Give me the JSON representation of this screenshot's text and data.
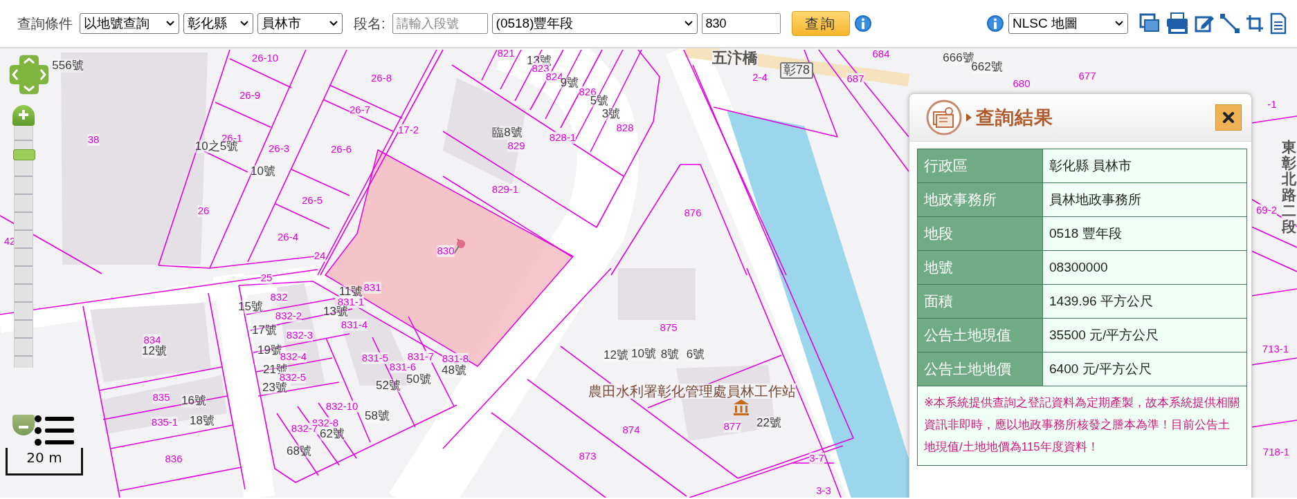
{
  "toolbar": {
    "query_label": "查詢條件",
    "query_mode": "以地號查詢",
    "county": "彰化縣",
    "town": "員林市",
    "section_label": "段名:",
    "section_input": {
      "placeholder": "請輸入段號"
    },
    "section": "(0518)豐年段",
    "parcel_input": {
      "value": "830"
    },
    "query_button": "查詢",
    "basemap": "NLSC 地圖"
  },
  "map": {
    "zoom_slider": {
      "level": 0.9
    },
    "scale_label": "20 m",
    "labels": [
      {
        "text": "556號",
        "kind": "address"
      },
      {
        "text": "26-10",
        "kind": "parcel"
      },
      {
        "text": "26-8",
        "kind": "parcel"
      },
      {
        "text": "26-9",
        "kind": "parcel"
      },
      {
        "text": "38",
        "kind": "parcel"
      },
      {
        "text": "26-1",
        "kind": "parcel"
      },
      {
        "text": "10之5號",
        "kind": "address"
      },
      {
        "text": "26-3",
        "kind": "parcel"
      },
      {
        "text": "26-6",
        "kind": "parcel"
      },
      {
        "text": "17-2",
        "kind": "parcel"
      },
      {
        "text": "26-7",
        "kind": "parcel"
      },
      {
        "text": "10號",
        "kind": "address"
      },
      {
        "text": "26-5",
        "kind": "parcel"
      },
      {
        "text": "26",
        "kind": "parcel"
      },
      {
        "text": "26-4",
        "kind": "parcel"
      },
      {
        "text": "24",
        "kind": "parcel"
      },
      {
        "text": "42",
        "kind": "parcel"
      },
      {
        "text": "830",
        "kind": "parcel"
      },
      {
        "text": "25",
        "kind": "parcel"
      },
      {
        "text": "832",
        "kind": "parcel"
      },
      {
        "text": "11號",
        "kind": "address"
      },
      {
        "text": "831",
        "kind": "parcel"
      },
      {
        "text": "15號",
        "kind": "address"
      },
      {
        "text": "831-1",
        "kind": "parcel"
      },
      {
        "text": "832-2",
        "kind": "parcel"
      },
      {
        "text": "13號",
        "kind": "address"
      },
      {
        "text": "831-4",
        "kind": "parcel"
      },
      {
        "text": "17號",
        "kind": "address"
      },
      {
        "text": "832-3",
        "kind": "parcel"
      },
      {
        "text": "834",
        "kind": "parcel"
      },
      {
        "text": "12號",
        "kind": "address"
      },
      {
        "text": "19號",
        "kind": "address"
      },
      {
        "text": "21號",
        "kind": "address"
      },
      {
        "text": "832-4",
        "kind": "parcel"
      },
      {
        "text": "831-5",
        "kind": "parcel"
      },
      {
        "text": "831-7",
        "kind": "parcel"
      },
      {
        "text": "831-6",
        "kind": "parcel"
      },
      {
        "text": "832-5",
        "kind": "parcel"
      },
      {
        "text": "831-8",
        "kind": "parcel"
      },
      {
        "text": "48號",
        "kind": "address"
      },
      {
        "text": "50號",
        "kind": "address"
      },
      {
        "text": "23號",
        "kind": "address"
      },
      {
        "text": "52號",
        "kind": "address"
      },
      {
        "text": "835",
        "kind": "parcel"
      },
      {
        "text": "16號",
        "kind": "address"
      },
      {
        "text": "832-10",
        "kind": "parcel"
      },
      {
        "text": "58號",
        "kind": "address"
      },
      {
        "text": "832-8",
        "kind": "parcel"
      },
      {
        "text": "832-7",
        "kind": "parcel"
      },
      {
        "text": "62號",
        "kind": "address"
      },
      {
        "text": "835-1",
        "kind": "parcel"
      },
      {
        "text": "18號",
        "kind": "address"
      },
      {
        "text": "836",
        "kind": "parcel"
      },
      {
        "text": "68號",
        "kind": "address"
      },
      {
        "text": "821",
        "kind": "parcel"
      },
      {
        "text": "13號",
        "kind": "address"
      },
      {
        "text": "823",
        "kind": "parcel"
      },
      {
        "text": "824",
        "kind": "parcel"
      },
      {
        "text": "9號",
        "kind": "address"
      },
      {
        "text": "826",
        "kind": "parcel"
      },
      {
        "text": "5號",
        "kind": "address"
      },
      {
        "text": "3號",
        "kind": "address"
      },
      {
        "text": "臨8號",
        "kind": "address"
      },
      {
        "text": "828",
        "kind": "parcel"
      },
      {
        "text": "829",
        "kind": "parcel"
      },
      {
        "text": "828-1",
        "kind": "parcel"
      },
      {
        "text": "829-1",
        "kind": "parcel"
      },
      {
        "text": "876",
        "kind": "parcel"
      },
      {
        "text": "五汴橋",
        "kind": "bridge"
      },
      {
        "text": "2-4",
        "kind": "parcel"
      },
      {
        "text": "彰78",
        "kind": "route"
      },
      {
        "text": "684",
        "kind": "parcel"
      },
      {
        "text": "687",
        "kind": "parcel"
      },
      {
        "text": "666號",
        "kind": "address"
      },
      {
        "text": "662號",
        "kind": "address"
      },
      {
        "text": "680",
        "kind": "parcel"
      },
      {
        "text": "677",
        "kind": "parcel"
      },
      {
        "text": "875",
        "kind": "parcel"
      },
      {
        "text": "12號",
        "kind": "address"
      },
      {
        "text": "10號",
        "kind": "address"
      },
      {
        "text": "8號",
        "kind": "address"
      },
      {
        "text": "6號",
        "kind": "address"
      },
      {
        "text": "農田水利署彰化管理處員林工作站",
        "kind": "place"
      },
      {
        "text": "877",
        "kind": "parcel"
      },
      {
        "text": "22號",
        "kind": "address"
      },
      {
        "text": "874",
        "kind": "parcel"
      },
      {
        "text": "873",
        "kind": "parcel"
      },
      {
        "text": "3-7",
        "kind": "parcel"
      },
      {
        "text": "3-3",
        "kind": "parcel"
      },
      {
        "text": "-1",
        "kind": "parcel"
      },
      {
        "text": "東彰北路二段",
        "kind": "road"
      },
      {
        "text": "69-2",
        "kind": "parcel"
      },
      {
        "text": "713-1",
        "kind": "parcel"
      },
      {
        "text": "718-1",
        "kind": "parcel"
      }
    ]
  },
  "result_panel": {
    "title": "查詢結果",
    "rows": [
      {
        "label": "行政區",
        "value": "彰化縣 員林市"
      },
      {
        "label": "地政事務所",
        "value": "員林地政事務所"
      },
      {
        "label": "地段",
        "value": "0518 豐年段"
      },
      {
        "label": "地號",
        "value": "08300000"
      },
      {
        "label": "面積",
        "value": "1439.96 平方公尺"
      },
      {
        "label": "公告土地現值",
        "value": "35500 元/平方公尺"
      },
      {
        "label": "公告土地地價",
        "value": "6400 元/平方公尺"
      }
    ],
    "notice": "※本系統提供查詢之登記資料為定期產製，故本系統提供相關資訊非即時，應以地政事務所核發之謄本為準！目前公告土地現值/土地地價為115年度資料！"
  }
}
